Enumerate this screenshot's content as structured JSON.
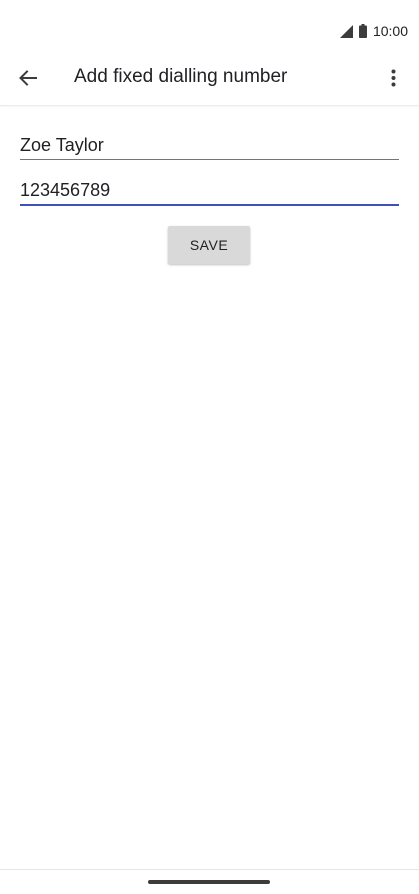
{
  "status_bar": {
    "time": "10:00",
    "icons": [
      "signal-icon",
      "battery-icon"
    ]
  },
  "app_bar": {
    "title": "Add fixed dialling number",
    "back_icon": "arrow-back-icon",
    "overflow_icon": "more-vert-icon"
  },
  "form": {
    "name_value": "Zoe Taylor",
    "number_value": "123456789",
    "save_label": "SAVE"
  },
  "colors": {
    "focused_underline": "#3f51b5",
    "button_bg": "#d9d9d9"
  }
}
